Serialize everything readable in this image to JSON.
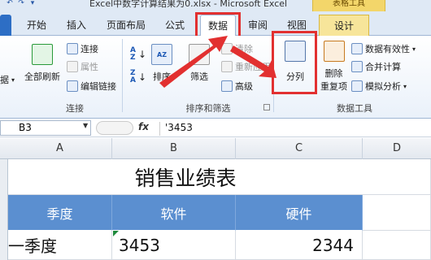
{
  "titlebar": {
    "qat": [
      "undo-icon",
      "redo-icon",
      "dropdown-icon"
    ],
    "title": "Excel中数字计算结果为0.xlsx - Microsoft Excel",
    "context_tab_group": "表格工具"
  },
  "tabs": [
    {
      "label": "文件"
    },
    {
      "label": "开始"
    },
    {
      "label": "插入"
    },
    {
      "label": "页面布局"
    },
    {
      "label": "公式"
    },
    {
      "label": "数据",
      "active": true
    },
    {
      "label": "审阅"
    },
    {
      "label": "视图"
    },
    {
      "label": "设计"
    }
  ],
  "ribbon": {
    "connections": {
      "group_label": "连接",
      "refresh_all": "全部刷新",
      "get_external_partial": "据",
      "connections": "连接",
      "properties": "属性",
      "edit_links": "编辑链接"
    },
    "sort_filter": {
      "group_label": "排序和筛选",
      "sort": "排序",
      "filter": "筛选",
      "clear": "清除",
      "reapply": "重新应用",
      "advanced": "高级"
    },
    "data_tools": {
      "group_label": "数据工具",
      "text_to_columns": "分列",
      "remove_duplicates_1": "删除",
      "remove_duplicates_2": "重复项",
      "data_validation": "数据有效性",
      "consolidate": "合并计算",
      "what_if": "模拟分析"
    }
  },
  "formula_bar": {
    "name_box": "B3",
    "fx": "fx",
    "content": "'3453"
  },
  "grid": {
    "columns": [
      "A",
      "B",
      "C",
      "D"
    ],
    "title": "销售业绩表",
    "headers": [
      "季度",
      "软件",
      "硬件"
    ],
    "row3": [
      "一季度",
      "3453",
      "2344"
    ]
  },
  "colors": {
    "header_fill": "#5b8fd0",
    "highlight": "#e23030",
    "active_tab_border": "#9fb6d4"
  }
}
